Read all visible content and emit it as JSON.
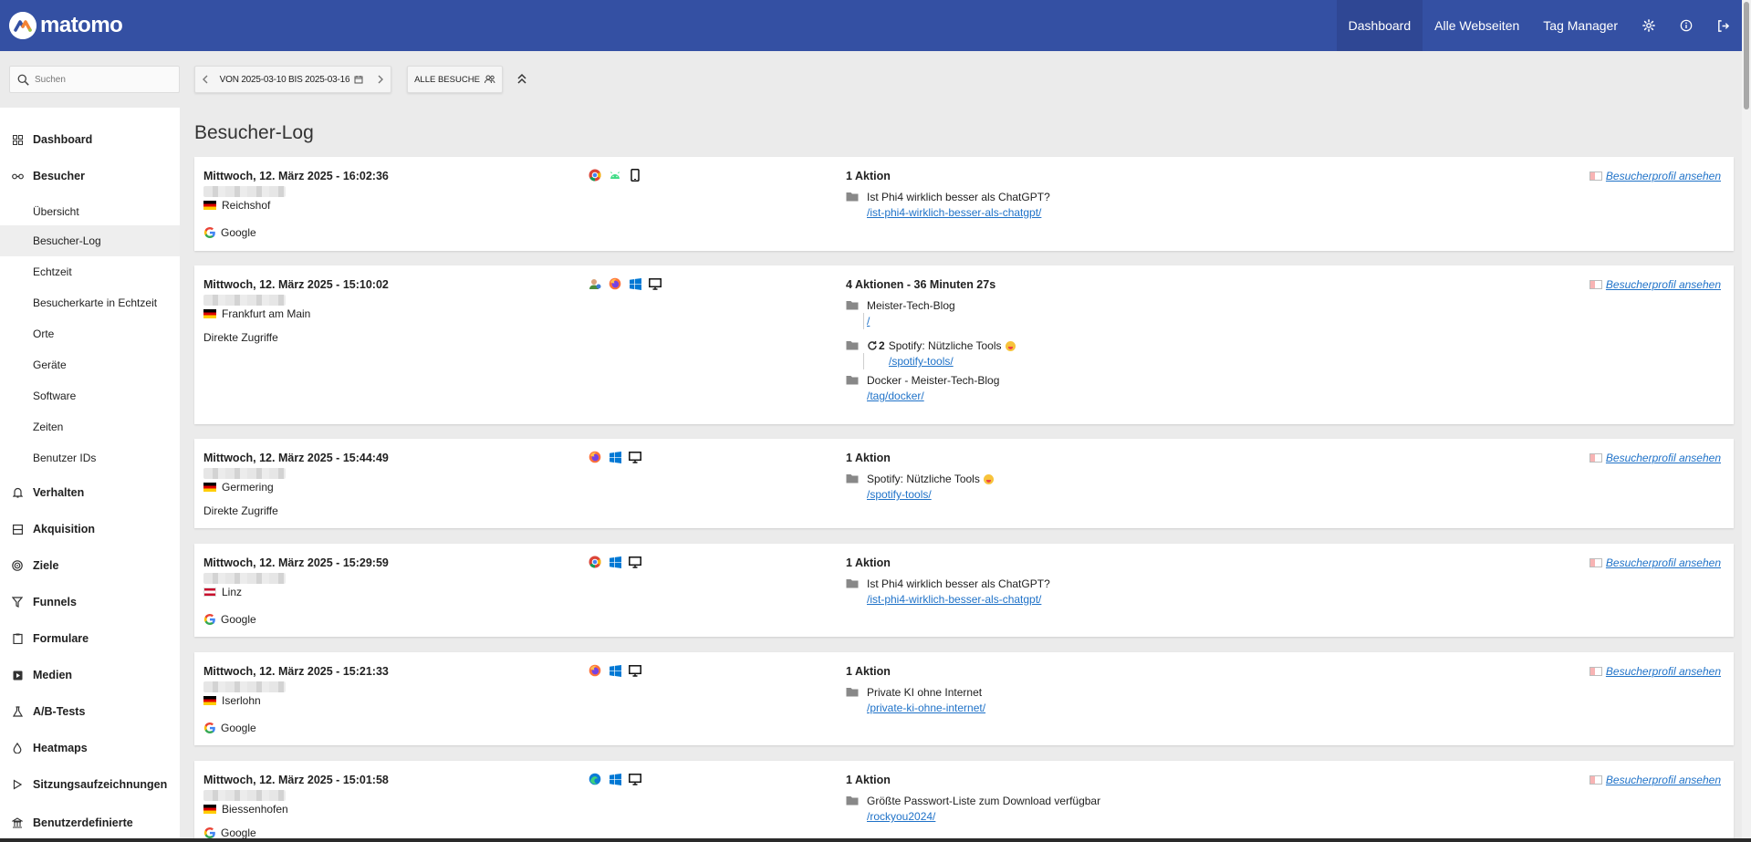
{
  "brand": {
    "name": "matomo"
  },
  "topnav": {
    "items": [
      {
        "label": "Dashboard",
        "active": true
      },
      {
        "label": "Alle Webseiten",
        "active": false
      },
      {
        "label": "Tag Manager",
        "active": false
      }
    ],
    "icons": [
      "gear-icon",
      "info-icon",
      "logout-icon"
    ]
  },
  "search": {
    "placeholder": "Suchen"
  },
  "period": {
    "label": "VON 2025-03-10 BIS 2025-03-16"
  },
  "segment": {
    "label": "ALLE BESUCHE"
  },
  "sidebar": {
    "items": [
      {
        "label": "Dashboard",
        "icon": "grid-icon",
        "level": 0
      },
      {
        "label": "Besucher",
        "icon": "glasses-icon",
        "level": 0
      },
      {
        "label": "Übersicht",
        "level": 1
      },
      {
        "label": "Besucher-Log",
        "level": 1,
        "selected": true
      },
      {
        "label": "Echtzeit",
        "level": 1
      },
      {
        "label": "Besucherkarte in Echtzeit",
        "level": 1
      },
      {
        "label": "Orte",
        "level": 1
      },
      {
        "label": "Geräte",
        "level": 1
      },
      {
        "label": "Software",
        "level": 1
      },
      {
        "label": "Zeiten",
        "level": 1
      },
      {
        "label": "Benutzer IDs",
        "level": 1
      },
      {
        "label": "Verhalten",
        "icon": "bell-icon",
        "level": 0
      },
      {
        "label": "Akquisition",
        "icon": "acquisition-icon",
        "level": 0
      },
      {
        "label": "Ziele",
        "icon": "target-icon",
        "level": 0
      },
      {
        "label": "Funnels",
        "icon": "funnel-icon",
        "level": 0
      },
      {
        "label": "Formulare",
        "icon": "clipboard-icon",
        "level": 0
      },
      {
        "label": "Medien",
        "icon": "media-icon",
        "level": 0
      },
      {
        "label": "A/B-Tests",
        "icon": "flask-icon",
        "level": 0
      },
      {
        "label": "Heatmaps",
        "icon": "drop-icon",
        "level": 0
      },
      {
        "label": "Sitzungsaufzeichnungen",
        "icon": "play-icon",
        "level": 0
      },
      {
        "label": "Benutzerdefinierte",
        "icon": "building-icon",
        "level": 0
      }
    ]
  },
  "page": {
    "title": "Besucher-Log"
  },
  "profile_link": "Besucherprofil ansehen",
  "visits": [
    {
      "datetime": "Mittwoch, 12. März 2025 - 16:02:36",
      "country": "de",
      "city": "Reichshof",
      "referrer": "Google",
      "referrer_icon": "google-icon",
      "icons": [
        "chrome-icon",
        "android-icon",
        "smartphone-icon"
      ],
      "summary": "1 Aktion",
      "actions": [
        {
          "title": "Ist Phi4 wirklich besser als ChatGPT?",
          "url": "/ist-phi4-wirklich-besser-als-chatgpt/"
        }
      ]
    },
    {
      "datetime": "Mittwoch, 12. März 2025 - 15:10:02",
      "country": "de",
      "city": "Frankfurt am Main",
      "referrer": "Direkte Zugriffe",
      "referrer_icon": "",
      "icons": [
        "returning-visitor-icon",
        "firefox-icon",
        "windows-icon",
        "desktop-icon"
      ],
      "summary": "4 Aktionen - 36 Minuten 27s",
      "actions": [
        {
          "title": "Meister-Tech-Blog",
          "url": "/"
        },
        {
          "title": "Spotify: Nützliche Tools",
          "url": "/spotify-tools/",
          "repeat": "2",
          "emoji": true
        },
        {
          "title": "Docker - Meister-Tech-Blog",
          "url": "/tag/docker/"
        }
      ]
    },
    {
      "datetime": "Mittwoch, 12. März 2025 - 15:44:49",
      "country": "de",
      "city": "Germering",
      "referrer": "Direkte Zugriffe",
      "referrer_icon": "",
      "icons": [
        "firefox-icon",
        "windows-icon",
        "desktop-icon"
      ],
      "summary": "1 Aktion",
      "actions": [
        {
          "title": "Spotify: Nützliche Tools",
          "url": "/spotify-tools/",
          "emoji": true
        }
      ]
    },
    {
      "datetime": "Mittwoch, 12. März 2025 - 15:29:59",
      "country": "at",
      "city": "Linz",
      "referrer": "Google",
      "referrer_icon": "google-icon",
      "icons": [
        "chrome-icon",
        "windows-icon",
        "desktop-icon"
      ],
      "summary": "1 Aktion",
      "actions": [
        {
          "title": "Ist Phi4 wirklich besser als ChatGPT?",
          "url": "/ist-phi4-wirklich-besser-als-chatgpt/"
        }
      ]
    },
    {
      "datetime": "Mittwoch, 12. März 2025 - 15:21:33",
      "country": "de",
      "city": "Iserlohn",
      "referrer": "Google",
      "referrer_icon": "google-icon",
      "icons": [
        "firefox-icon",
        "windows-icon",
        "desktop-icon"
      ],
      "summary": "1 Aktion",
      "actions": [
        {
          "title": "Private KI ohne Internet",
          "url": "/private-ki-ohne-internet/"
        }
      ]
    },
    {
      "datetime": "Mittwoch, 12. März 2025 - 15:01:58",
      "country": "de",
      "city": "Biessenhofen",
      "referrer": "Google",
      "referrer_icon": "google-icon",
      "icons": [
        "edge-icon",
        "windows-icon",
        "desktop-icon"
      ],
      "summary": "1 Aktion",
      "actions": [
        {
          "title": "Größte Passwort-Liste zum Download verfügbar",
          "url": "/rockyou2024/"
        }
      ]
    }
  ]
}
